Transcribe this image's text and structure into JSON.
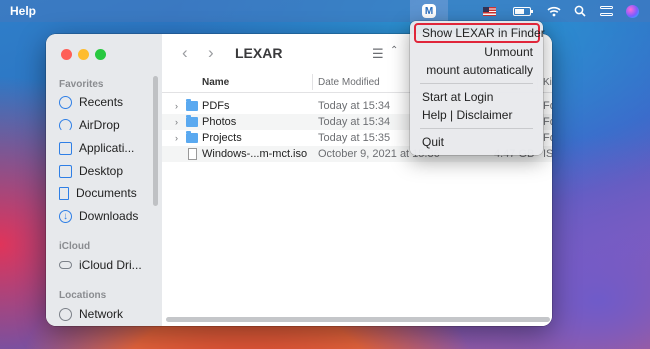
{
  "menubar": {
    "app_menu": "Help",
    "lexar_icon": "M",
    "icons": [
      "lexar-app-icon",
      "us-flag-icon",
      "battery-icon",
      "wifi-icon",
      "spotlight-search-icon",
      "control-center-icon",
      "siri-icon"
    ]
  },
  "dropdown": {
    "items": [
      {
        "label": "Show LEXAR in Finder",
        "highlighted": true
      },
      {
        "label": "Unmount"
      },
      {
        "label": "mount automatically"
      },
      {
        "label": "Start at Login"
      },
      {
        "label": "Help | Disclaimer"
      },
      {
        "label": "Quit"
      }
    ],
    "highlight_color": "#e0263a"
  },
  "finder": {
    "title": "LEXAR",
    "nav": {
      "back": "‹",
      "forward": "›"
    },
    "view_icon": "list-view-icon",
    "sidebar": {
      "favorites_heading": "Favorites",
      "favorites": [
        {
          "label": "Recents",
          "icon": "clock-icon"
        },
        {
          "label": "AirDrop",
          "icon": "airdrop-icon"
        },
        {
          "label": "Applicati...",
          "icon": "applications-icon"
        },
        {
          "label": "Desktop",
          "icon": "desktop-icon"
        },
        {
          "label": "Documents",
          "icon": "document-icon"
        },
        {
          "label": "Downloads",
          "icon": "download-icon"
        }
      ],
      "icloud_heading": "iCloud",
      "icloud": [
        {
          "label": "iCloud Dri...",
          "icon": "cloud-icon"
        }
      ],
      "locations_heading": "Locations",
      "locations": [
        {
          "label": "Network",
          "icon": "network-globe-icon"
        }
      ]
    },
    "columns": {
      "name": "Name",
      "date": "Date Modified",
      "kind": "Ki"
    },
    "rows": [
      {
        "name": "PDFs",
        "date": "Today at 15:34",
        "size": "",
        "kind": "Fo",
        "type": "folder"
      },
      {
        "name": "Photos",
        "date": "Today at 15:34",
        "size": "",
        "kind": "Fo",
        "type": "folder"
      },
      {
        "name": "Projects",
        "date": "Today at 15:35",
        "size": "",
        "kind": "Fo",
        "type": "folder"
      },
      {
        "name": "Windows-...m-mct.iso",
        "date": "October 9, 2021 at 15:36",
        "size": "4.47 GB",
        "kind": "IS",
        "type": "file"
      }
    ]
  },
  "colors": {
    "accent": "#2f7fe6",
    "folder": "#5aa9f0"
  }
}
